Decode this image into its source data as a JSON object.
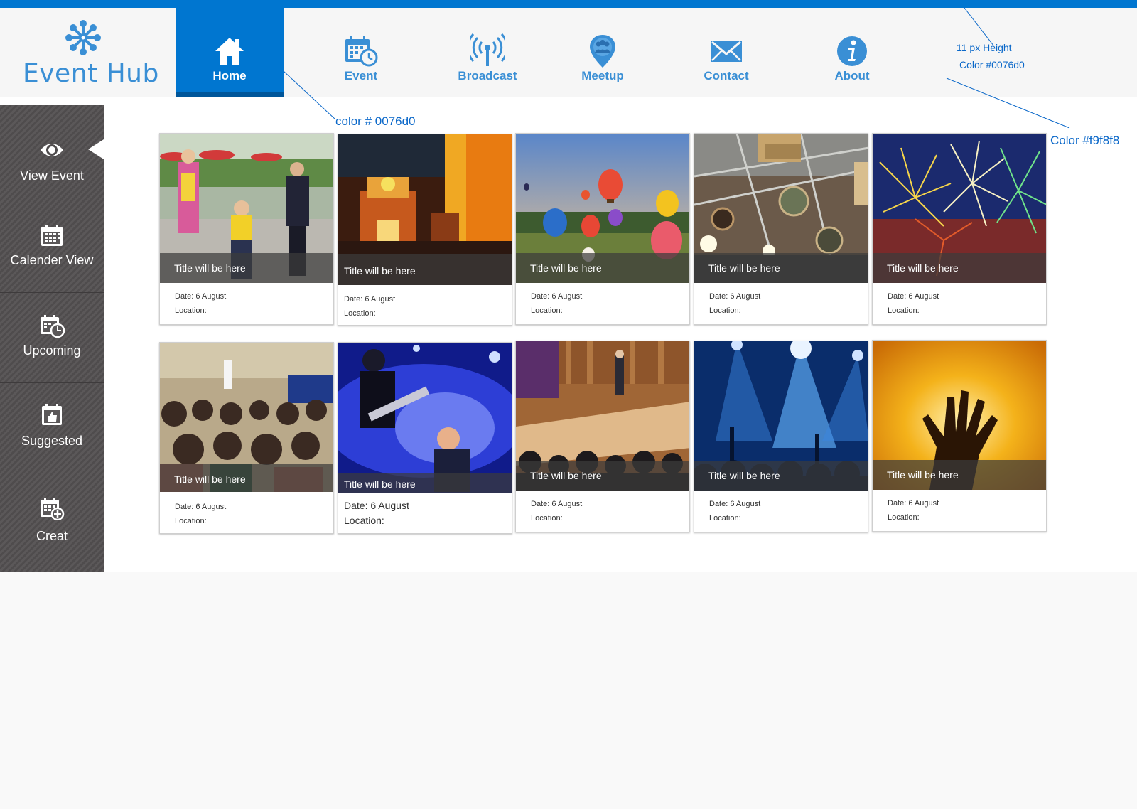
{
  "app": {
    "logo_text": "Event Hub",
    "accent_color": "#0076d0",
    "header_bg": "#f9f8f8"
  },
  "nav": {
    "items": [
      {
        "label": "Home",
        "icon": "home-icon",
        "active": true
      },
      {
        "label": "Event",
        "icon": "calendar-clock-icon",
        "active": false
      },
      {
        "label": "Broadcast",
        "icon": "broadcast-icon",
        "active": false
      },
      {
        "label": "Meetup",
        "icon": "meetup-pin-icon",
        "active": false
      },
      {
        "label": "Contact",
        "icon": "mail-icon",
        "active": false
      },
      {
        "label": "About",
        "icon": "info-icon",
        "active": false
      }
    ]
  },
  "annotations": {
    "topbar_height": "11 px Height",
    "topbar_color": "Color #0076d0",
    "home_color": "color # 0076d0",
    "header_color": "Color #f9f8f8"
  },
  "sidebar": {
    "items": [
      {
        "label": "View Event",
        "icon": "eye-icon",
        "active": true
      },
      {
        "label": "Calender View",
        "icon": "calendar-icon",
        "active": false
      },
      {
        "label": "Upcoming",
        "icon": "calendar-clock-icon",
        "active": false
      },
      {
        "label": "Suggested",
        "icon": "calendar-thumb-icon",
        "active": false
      },
      {
        "label": "Creat",
        "icon": "calendar-add-icon",
        "active": false
      }
    ]
  },
  "cards": [
    {
      "title": "Title will be here",
      "date": "Date: 6 August",
      "location": "Location:",
      "image": "jugglers"
    },
    {
      "title": "Title will be here",
      "date": "Date: 6 August",
      "location": "Location:",
      "image": "restaurant"
    },
    {
      "title": "Title will be here",
      "date": "Date: 6 August",
      "location": "Location:",
      "image": "balloons"
    },
    {
      "title": "Title will be here",
      "date": "Date: 6 August",
      "location": "Location:",
      "image": "exhibition"
    },
    {
      "title": "Title will be here",
      "date": "Date: 6 August",
      "location": "Location:",
      "image": "fireworks"
    },
    {
      "title": "Title will be here",
      "date": "Date: 6 August",
      "location": "Location:",
      "image": "lecture"
    },
    {
      "title": "Title will be here",
      "date": "Date: 6 August",
      "location": "Location:",
      "image": "concert-guitar"
    },
    {
      "title": "Title will be here",
      "date": "Date: 6 August",
      "location": "Location:",
      "image": "stage-talk"
    },
    {
      "title": "Title will be here",
      "date": "Date: 6 August",
      "location": "Location:",
      "image": "concert-lights"
    },
    {
      "title": "Title will be here",
      "date": "Date: 6 August",
      "location": "Location:",
      "image": "hand-silhouette"
    }
  ]
}
